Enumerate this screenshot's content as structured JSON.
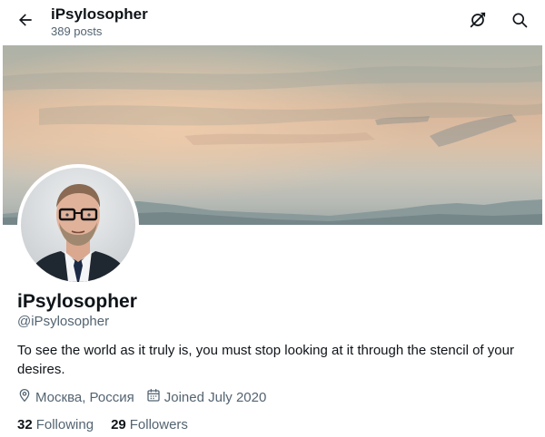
{
  "header": {
    "title": "iPsylosopher",
    "post_count": "389 posts",
    "back_icon": "arrow-left-icon",
    "alt_icon": "bird-crossed-icon",
    "search_icon": "search-icon"
  },
  "profile": {
    "display_name": "iPsylosopher",
    "handle": "@iPsylosopher",
    "bio": "To see the world as it truly is, you must stop looking at it through the stencil of your desires.",
    "location": "Москва, Россия",
    "joined": "Joined July 2020",
    "following_count": "32",
    "following_label": "Following",
    "followers_count": "29",
    "followers_label": "Followers"
  },
  "colors": {
    "text_primary": "#0f1419",
    "text_secondary": "#536471"
  }
}
